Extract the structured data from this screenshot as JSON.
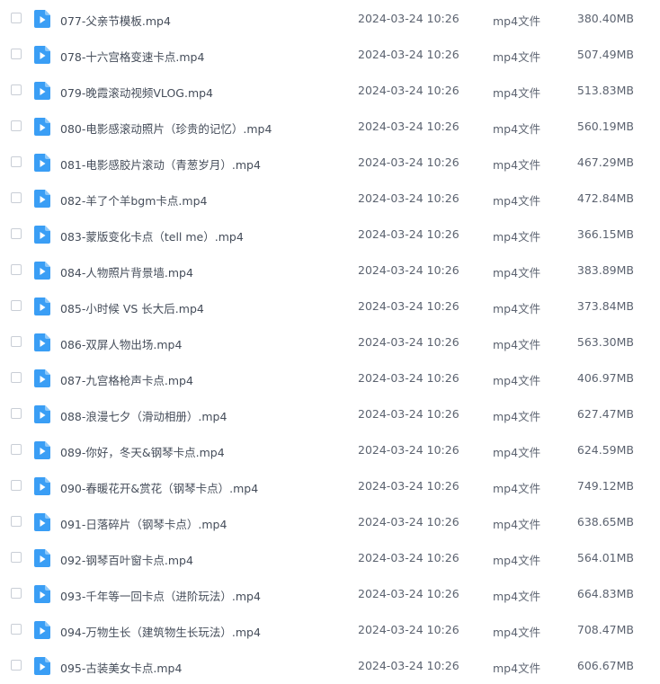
{
  "file_list": {
    "type_label": "mp4文件",
    "icon": "video-file-icon",
    "icon_color": "#3a9ef5",
    "rows": [
      {
        "name": "077-父亲节模板.mp4",
        "date": "2024-03-24 10:26",
        "type": "mp4文件",
        "size": "380.40MB"
      },
      {
        "name": "078-十六宫格变速卡点.mp4",
        "date": "2024-03-24 10:26",
        "type": "mp4文件",
        "size": "507.49MB"
      },
      {
        "name": "079-晚霞滚动视频VLOG.mp4",
        "date": "2024-03-24 10:26",
        "type": "mp4文件",
        "size": "513.83MB"
      },
      {
        "name": "080-电影感滚动照片（珍贵的记忆）.mp4",
        "date": "2024-03-24 10:26",
        "type": "mp4文件",
        "size": "560.19MB"
      },
      {
        "name": "081-电影感胶片滚动（青葱岁月）.mp4",
        "date": "2024-03-24 10:26",
        "type": "mp4文件",
        "size": "467.29MB"
      },
      {
        "name": "082-羊了个羊bgm卡点.mp4",
        "date": "2024-03-24 10:26",
        "type": "mp4文件",
        "size": "472.84MB"
      },
      {
        "name": "083-蒙版变化卡点（tell me）.mp4",
        "date": "2024-03-24 10:26",
        "type": "mp4文件",
        "size": "366.15MB"
      },
      {
        "name": "084-人物照片背景墙.mp4",
        "date": "2024-03-24 10:26",
        "type": "mp4文件",
        "size": "383.89MB"
      },
      {
        "name": "085-小时候 VS 长大后.mp4",
        "date": "2024-03-24 10:26",
        "type": "mp4文件",
        "size": "373.84MB"
      },
      {
        "name": "086-双屏人物出场.mp4",
        "date": "2024-03-24 10:26",
        "type": "mp4文件",
        "size": "563.30MB"
      },
      {
        "name": "087-九宫格枪声卡点.mp4",
        "date": "2024-03-24 10:26",
        "type": "mp4文件",
        "size": "406.97MB"
      },
      {
        "name": "088-浪漫七夕（滑动相册）.mp4",
        "date": "2024-03-24 10:26",
        "type": "mp4文件",
        "size": "627.47MB"
      },
      {
        "name": "089-你好，冬天&钢琴卡点.mp4",
        "date": "2024-03-24 10:26",
        "type": "mp4文件",
        "size": "624.59MB"
      },
      {
        "name": "090-春暖花开&赏花（钢琴卡点）.mp4",
        "date": "2024-03-24 10:26",
        "type": "mp4文件",
        "size": "749.12MB"
      },
      {
        "name": "091-日落碎片（钢琴卡点）.mp4",
        "date": "2024-03-24 10:26",
        "type": "mp4文件",
        "size": "638.65MB"
      },
      {
        "name": "092-钢琴百叶窗卡点.mp4",
        "date": "2024-03-24 10:26",
        "type": "mp4文件",
        "size": "564.01MB"
      },
      {
        "name": "093-千年等一回卡点（进阶玩法）.mp4",
        "date": "2024-03-24 10:26",
        "type": "mp4文件",
        "size": "664.83MB"
      },
      {
        "name": "094-万物生长（建筑物生长玩法）.mp4",
        "date": "2024-03-24 10:26",
        "type": "mp4文件",
        "size": "708.47MB"
      },
      {
        "name": "095-古装美女卡点.mp4",
        "date": "2024-03-24 10:26",
        "type": "mp4文件",
        "size": "606.67MB"
      }
    ]
  }
}
